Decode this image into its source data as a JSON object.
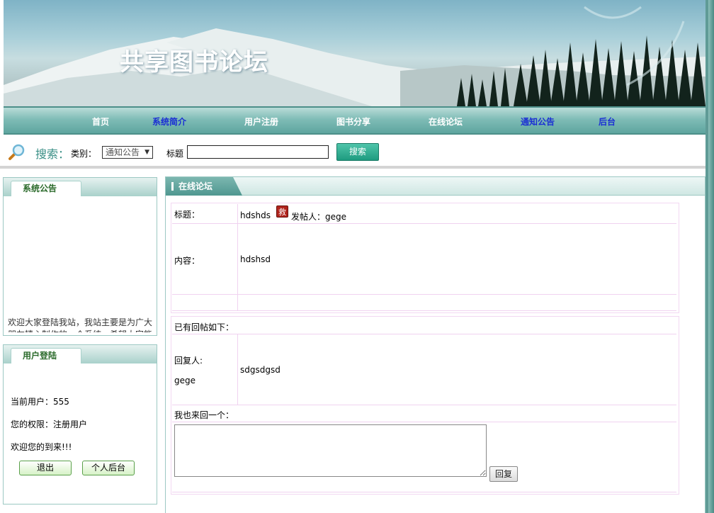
{
  "site": {
    "title": "共享图书论坛"
  },
  "nav": {
    "items": [
      {
        "label": "首页"
      },
      {
        "label": "系统简介"
      },
      {
        "label": "用户注册"
      },
      {
        "label": "图书分享"
      },
      {
        "label": "在线论坛"
      },
      {
        "label": "通知公告"
      },
      {
        "label": "后台"
      }
    ]
  },
  "search": {
    "label": "搜索：",
    "type_label": "类别：",
    "type_value": "通知公告",
    "title_label": "标题",
    "title_value": "",
    "button": "搜索"
  },
  "notice_panel": {
    "title": "系统公告",
    "text": "欢迎大家登陆我站，我站主要是为广大朋友精心制作的一个系统，希望大家能"
  },
  "login_panel": {
    "title": "用户登陆",
    "current_user": "当前用户：555",
    "permission": "您的权限：注册用户",
    "welcome": "欢迎您的到来!!!",
    "logout_button": "退出",
    "backend_button": "个人后台"
  },
  "forum": {
    "tab": "在线论坛",
    "post": {
      "title_label": "标题：",
      "title": "hdshds",
      "badge": "救",
      "poster": "发帖人：gege",
      "content_label": "内容：",
      "content": "hdshsd"
    },
    "replies_header": "已有回帖如下：",
    "replies": [
      {
        "replier_label": "回复人:",
        "replier": "gege",
        "content": "sdgsdgsd"
      }
    ],
    "reply_prompt": "我也来回一个：",
    "reply_value": "",
    "reply_button": "回复"
  },
  "colors": {
    "nav_bg": "#7fbcb6",
    "nav_active": "#1b2fd4",
    "accent": "#3a8f86",
    "search_button": "#1e9b7f",
    "badge": "#b0231c"
  }
}
